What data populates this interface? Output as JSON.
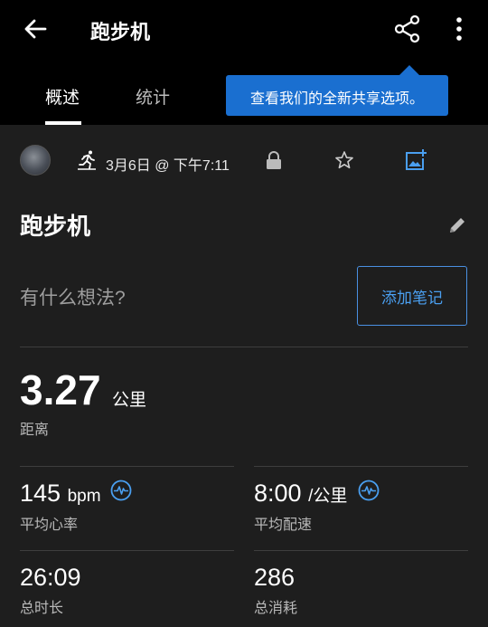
{
  "header": {
    "title": "跑步机",
    "tabs": {
      "overview": "概述",
      "stats": "统计"
    }
  },
  "tooltip": {
    "text": "查看我们的全新共享选项。"
  },
  "activity": {
    "date": "3月6日 @ 下午7:11",
    "name": "跑步机",
    "thought_placeholder": "有什么想法?",
    "add_note_label": "添加笔记"
  },
  "distance": {
    "value": "3.27",
    "unit": "公里",
    "label": "距离"
  },
  "stats": {
    "heart_rate": {
      "value": "145",
      "unit": "bpm",
      "label": "平均心率"
    },
    "pace": {
      "value": "8:00",
      "unit": "/公里",
      "label": "平均配速"
    },
    "duration": {
      "value": "26:09",
      "label": "总时长"
    },
    "calories": {
      "value": "286",
      "label": "总消耗"
    }
  },
  "colors": {
    "accent": "#4a9ff0",
    "tooltip": "#1a6fd0",
    "background": "#1e1e1e",
    "header": "#000000"
  },
  "icons": [
    "back-arrow-icon",
    "share-icon",
    "more-vert-icon",
    "running-icon",
    "lock-icon",
    "star-icon",
    "add-photo-icon",
    "pencil-icon",
    "heart-rate-icon"
  ]
}
